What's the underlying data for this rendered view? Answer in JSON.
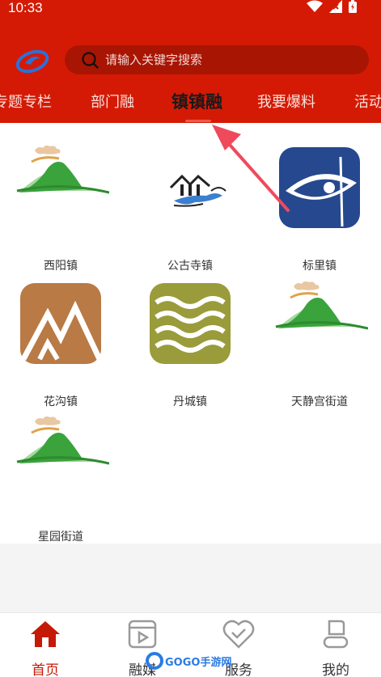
{
  "status": {
    "time": "10:33"
  },
  "search": {
    "placeholder": "请输入关键字搜索"
  },
  "tabs": [
    {
      "label": "专题专栏"
    },
    {
      "label": "部门融"
    },
    {
      "label": "镇镇融"
    },
    {
      "label": "我要爆料"
    },
    {
      "label": "活动"
    }
  ],
  "towns": [
    {
      "name": "西阳镇",
      "icon": "mountain-logo-icon"
    },
    {
      "name": "公古寺镇",
      "icon": "temple-logo-icon"
    },
    {
      "name": "标里镇",
      "icon": "fish-eye-logo-icon"
    },
    {
      "name": "花沟镇",
      "icon": "peaks-logo-icon"
    },
    {
      "name": "丹城镇",
      "icon": "waves-logo-icon"
    },
    {
      "name": "天静宫街道",
      "icon": "mountain-logo-icon"
    },
    {
      "name": "星园街道",
      "icon": "mountain-logo-icon"
    }
  ],
  "nav": [
    {
      "label": "首页"
    },
    {
      "label": "融媒"
    },
    {
      "label": "服务"
    },
    {
      "label": "我的"
    }
  ],
  "watermark": {
    "text": "GOGO手游网"
  },
  "colors": {
    "brand": "#d41a04",
    "active_nav": "#c41a06"
  }
}
